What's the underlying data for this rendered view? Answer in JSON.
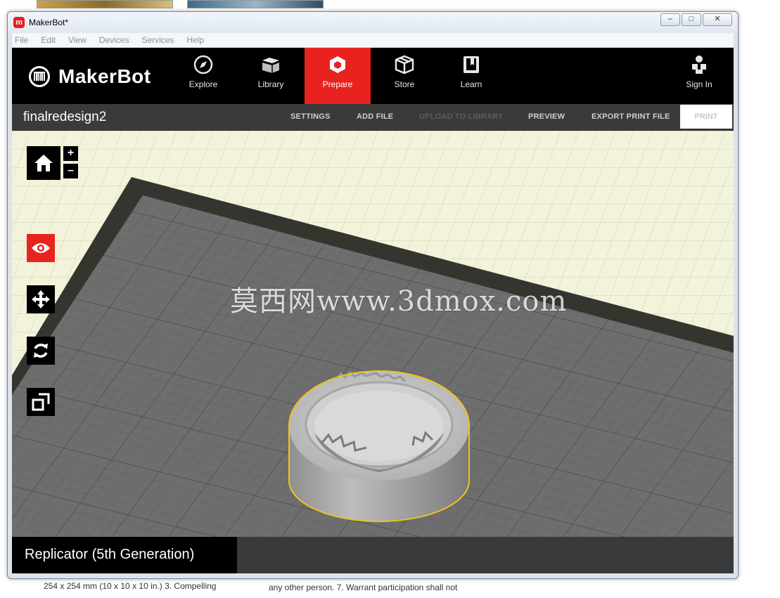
{
  "window": {
    "title": "MakerBot*",
    "app_icon_glyph": "m",
    "controls": [
      "–",
      "□",
      "✕"
    ]
  },
  "menu": [
    "File",
    "Edit",
    "View",
    "Devices",
    "Services",
    "Help"
  ],
  "nav": {
    "logo_text": "MakerBot",
    "tabs": [
      {
        "label": "Explore",
        "icon": "compass-icon"
      },
      {
        "label": "Library",
        "icon": "library-icon"
      },
      {
        "label": "Prepare",
        "icon": "prepare-icon",
        "active": true
      },
      {
        "label": "Store",
        "icon": "store-box-icon"
      },
      {
        "label": "Learn",
        "icon": "learn-book-icon"
      }
    ],
    "sign_in": "Sign In",
    "accent": "#e8231f"
  },
  "subbar": {
    "file_name": "finalredesign2",
    "buttons": {
      "settings": "SETTINGS",
      "add_file": "ADD FILE",
      "upload": "UPLOAD TO LIBRARY",
      "preview": "PREVIEW",
      "export": "EXPORT PRINT FILE",
      "print": "PRINT"
    }
  },
  "tools": {
    "zoom_in": "+",
    "zoom_out": "–"
  },
  "watermark": "莫西网www.3dmox.com",
  "printer": {
    "name": "Replicator (5th Generation)"
  },
  "background_page": {
    "left_text": "254 x 254 mm (10 x 10 x 10 in.) 3. Compelling",
    "right_text": "any other person. 7. Warrant participation shall not"
  }
}
